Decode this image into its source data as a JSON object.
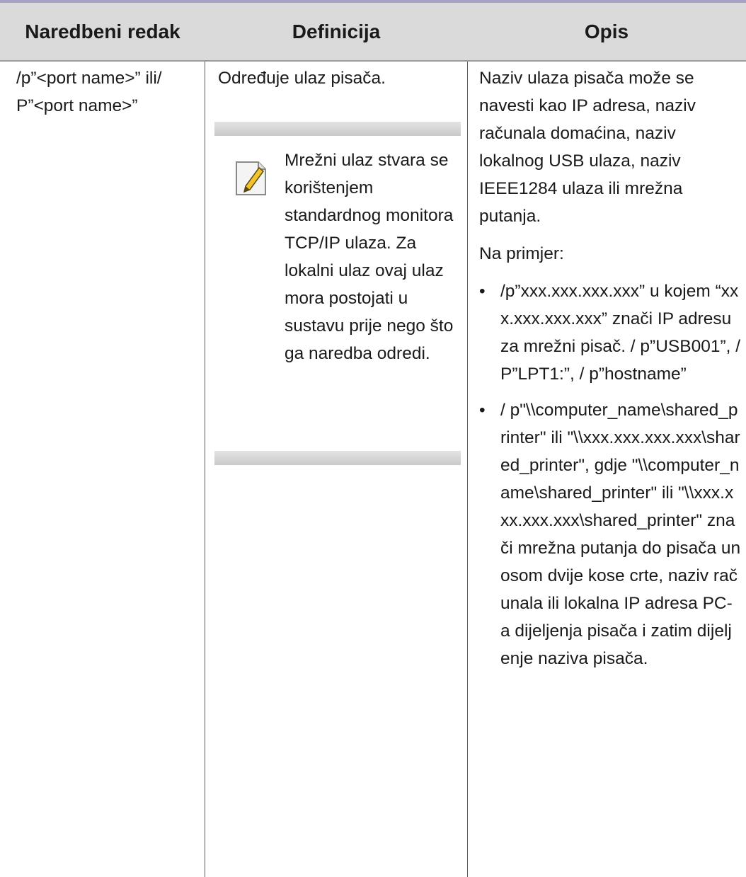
{
  "header": {
    "col1": "Naredbeni redak",
    "col2": "Definicija",
    "col3": "Opis"
  },
  "row": {
    "command": "/p”<port name>” ili/ P”<port name>”",
    "definition": "Određuje ulaz pisača.",
    "note": "Mrežni ulaz stvara se korištenjem standardnog monitora TCP/IP ulaza. Za lokalni ulaz ovaj ulaz mora postojati u sustavu prije nego što ga naredba odredi.",
    "description": "Naziv ulaza pisača može se navesti kao IP adresa, naziv računala domaćina, naziv lokalnog USB ulaza, naziv IEEE1284 ulaza ili mrežna putanja.",
    "example_label": "Na primjer:",
    "bullets": [
      "/p”xxx.xxx.xxx.xxx” u kojem “xxx.xxx.xxx.xxx” znači IP adresu za mrežni pisač. / p”USB001”, /P”LPT1:”, / p”hostname”",
      "/ p\"\\\\computer_name\\shared_printer\" ili \"\\\\xxx.xxx.xxx.xxx\\shared_printer\", gdje \"\\\\computer_name\\shared_printer\" ili \"\\\\xxx.xxx.xxx.xxx\\shared_printer\" znači mrežna putanja do pisača unosom dvije kose crte, naziv računala ili lokalna IP adresa PC-a dijeljenja pisača i zatim dijeljenje naziva pisača."
    ]
  },
  "icons": {
    "note": "note-pencil-icon"
  },
  "colors": {
    "header_bg": "#dadada",
    "top_rule": "#a6a2c4",
    "note_bar": "#d4d4d4"
  }
}
